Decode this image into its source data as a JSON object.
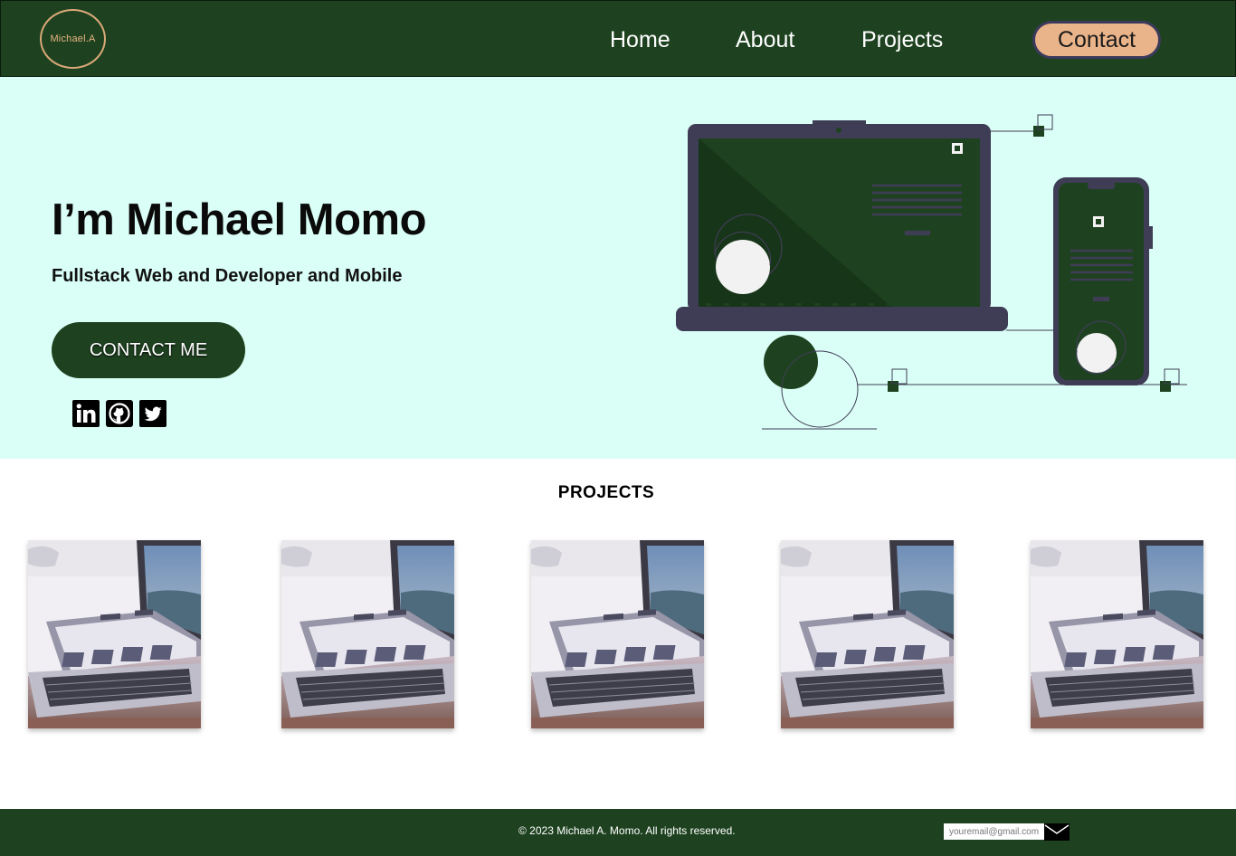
{
  "nav": {
    "logo_text": "Michael.A",
    "links": [
      {
        "label": "Home"
      },
      {
        "label": "About"
      },
      {
        "label": "Projects"
      }
    ],
    "contact_label": "Contact"
  },
  "hero": {
    "title": "I’m Michael Momo",
    "subtitle": "Fullstack Web and Developer and Mobile",
    "cta_label": "CONTACT ME",
    "social_icons": [
      "linkedin-icon",
      "github-icon",
      "twitter-icon"
    ]
  },
  "projects": {
    "heading": "PROJECTS",
    "count": 5
  },
  "footer": {
    "copyright": "© 2023 Michael A. Momo. All rights reserved.",
    "email_placeholder": "youremail@gmail.com"
  },
  "colors": {
    "primary_green": "#1e4220",
    "hero_bg": "#dafff6",
    "contact_button": "#eab48a",
    "logo_gold": "#e8b37f",
    "device_purple": "#3f3d56"
  }
}
